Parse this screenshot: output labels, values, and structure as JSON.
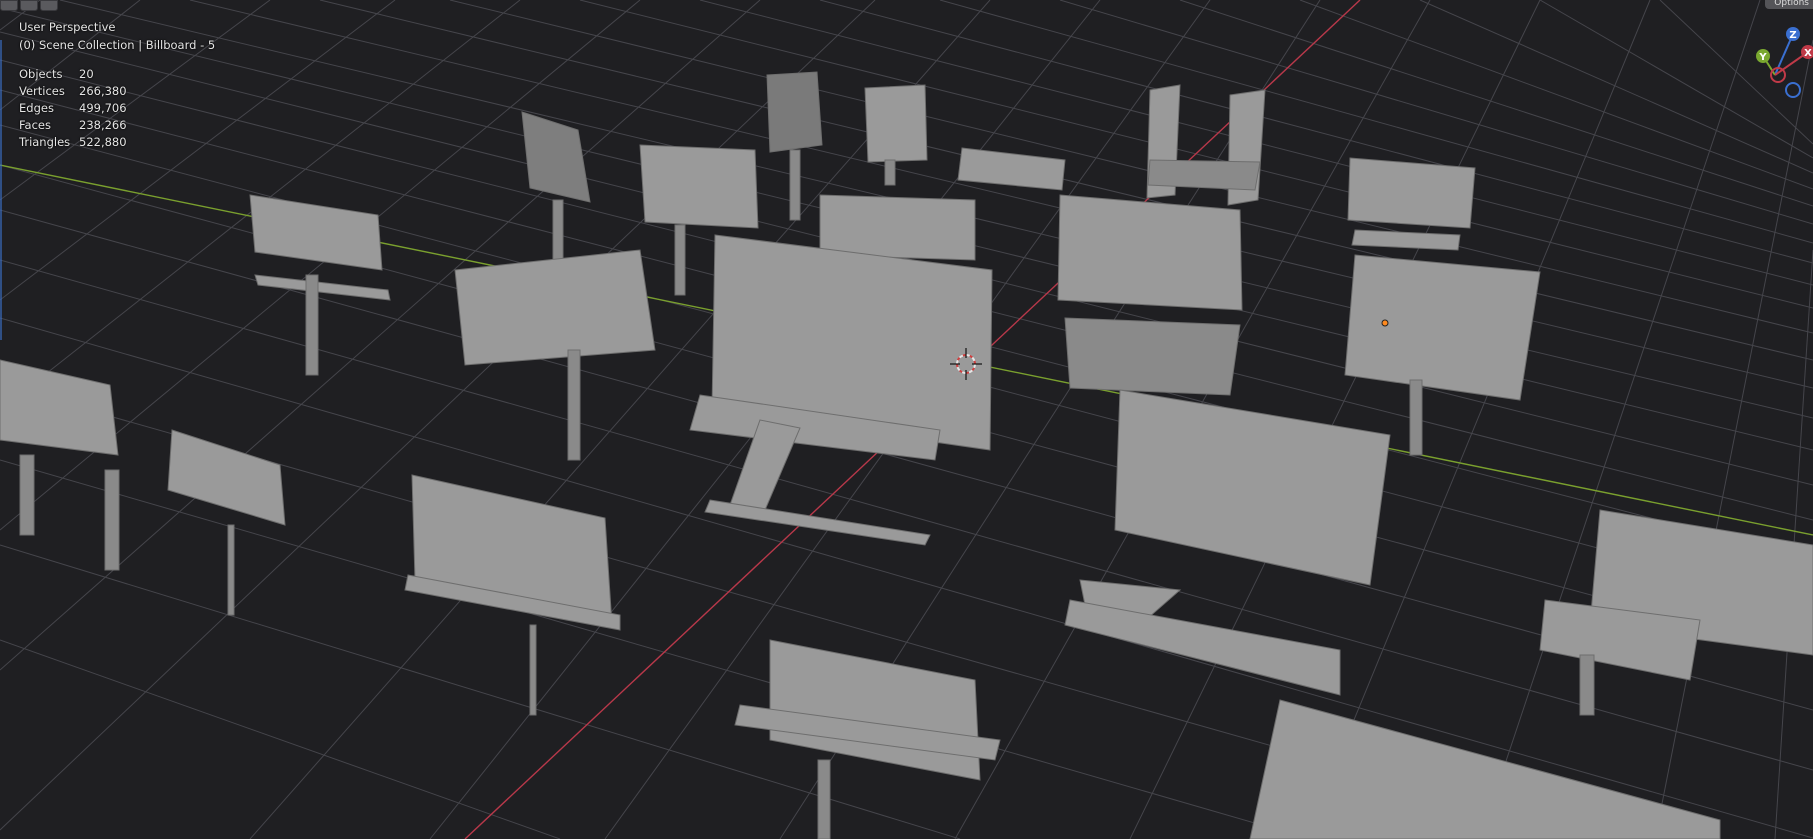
{
  "viewport": {
    "view_name": "User Perspective",
    "collection_line": "(0) Scene Collection | Billboard - 5",
    "stats": [
      {
        "label": "Objects",
        "value": "20"
      },
      {
        "label": "Vertices",
        "value": "266,380"
      },
      {
        "label": "Edges",
        "value": "499,706"
      },
      {
        "label": "Faces",
        "value": "238,266"
      },
      {
        "label": "Triangles",
        "value": "522,880"
      }
    ],
    "options_label": "Options",
    "gizmo": {
      "z": "Z",
      "y": "Y",
      "x": "X"
    },
    "colors": {
      "background": "#1f1f22",
      "grid": "#4a4a50",
      "x_axis": "#c03a48",
      "y_axis": "#7aa830",
      "mesh": "#9a9a9a",
      "origin": "#ff8a1e"
    }
  }
}
